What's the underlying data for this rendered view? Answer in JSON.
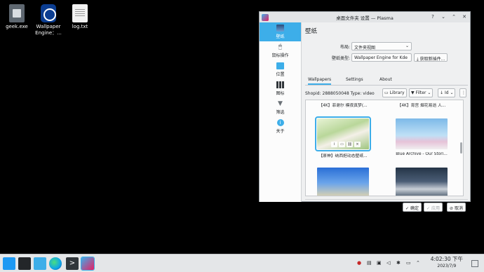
{
  "desktop": {
    "icons": [
      {
        "label": "geek.exe",
        "icon": "exe-file-icon"
      },
      {
        "label": "Wallpaper Engine：...",
        "icon": "wallpaper-engine-icon"
      },
      {
        "label": "log.txt",
        "icon": "text-file-icon"
      }
    ]
  },
  "window": {
    "title": "桌面文件夹 设置 — Plasma",
    "sidebar": [
      {
        "label": "壁纸",
        "icon": "wallpaper-icon"
      },
      {
        "label": "鼠标操作",
        "icon": "mouse-icon"
      },
      {
        "label": "位置",
        "icon": "folder-icon"
      },
      {
        "label": "图标",
        "icon": "icons-icon"
      },
      {
        "label": "筛选",
        "icon": "filter-icon"
      },
      {
        "label": "关于",
        "icon": "info-icon"
      }
    ],
    "page_title": "壁纸",
    "layout_label": "布局:",
    "layout_value": "文件夹视图",
    "wallpaper_type_label": "壁纸类型:",
    "wallpaper_type_value": "Wallpaper Engine for Kde",
    "get_plugins_label": "获取新插件...",
    "tabs": [
      "Wallpapers",
      "Settings",
      "About"
    ],
    "shopid_text": "Shopid: 2888050048  Type: video",
    "library_label": "Library",
    "filter_label": "Filter",
    "sort_label": "Id",
    "wallpapers": [
      {
        "caption": "【4K】菲谢尔 模夜真梦(..."
      },
      {
        "caption": "【4K】宵宫 烟花易逝 人..."
      },
      {
        "caption": "【原神】纳西妲动态壁纸..."
      },
      {
        "caption": "Blue Archive - Our Stori..."
      },
      {
        "caption": ""
      },
      {
        "caption": ""
      }
    ],
    "ok_label": "确定",
    "apply_label": "应用",
    "cancel_label": "取消"
  },
  "taskbar": {
    "time": "4:02:30 下午",
    "date": "2023/7/9"
  }
}
